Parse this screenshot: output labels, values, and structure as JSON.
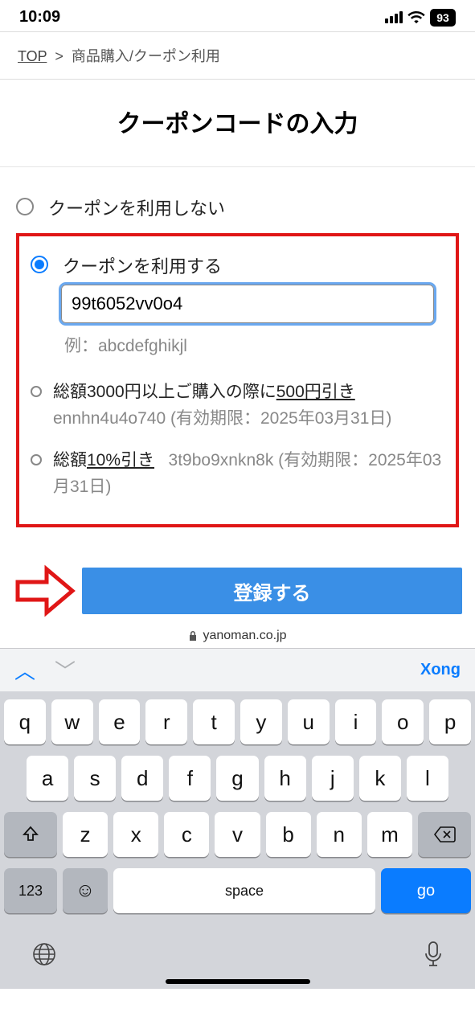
{
  "status": {
    "time": "10:09",
    "battery": "93"
  },
  "breadcrumb": {
    "top": "TOP",
    "sep": ">",
    "current": "商品購入/クーポン利用"
  },
  "title": "クーポンコードの入力",
  "options": {
    "none_label": "クーポンを利用しない",
    "use_label": "クーポンを利用する",
    "code_value": "99t6052vv0o4",
    "example": "例：abcdefghikjl"
  },
  "coupons": [
    {
      "prefix": "総額3000円以上ご購入の際に",
      "highlight": "500円引き",
      "sub": "ennhn4u4o740 (有効期限：2025年03月31日)"
    },
    {
      "prefix": "総額",
      "highlight": "10%引き",
      "code_suffix": "3t9bo9xnkn8k (有効期限：2025年03月31日)"
    }
  ],
  "submit_label": "登録する",
  "url": "yanoman.co.jp",
  "keyboard": {
    "done": "Xong",
    "row1": [
      "q",
      "w",
      "e",
      "r",
      "t",
      "y",
      "u",
      "i",
      "o",
      "p"
    ],
    "row2": [
      "a",
      "s",
      "d",
      "f",
      "g",
      "h",
      "j",
      "k",
      "l"
    ],
    "row3": [
      "z",
      "x",
      "c",
      "v",
      "b",
      "n",
      "m"
    ],
    "num": "123",
    "space": "space",
    "go": "go"
  }
}
